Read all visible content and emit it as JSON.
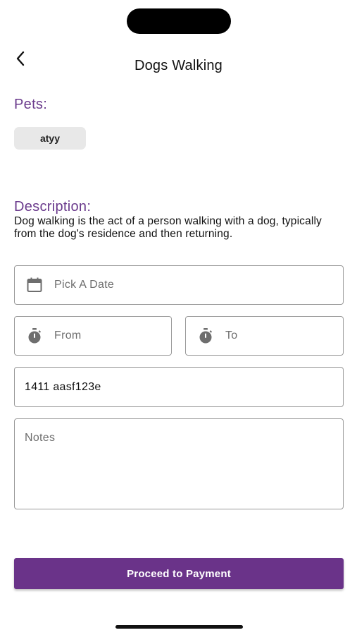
{
  "header": {
    "back_icon": "chevron-left-icon",
    "title": "Dogs Walking"
  },
  "pets": {
    "label": "Pets:",
    "chips": [
      "atyy"
    ]
  },
  "description": {
    "label": "Description:",
    "text": "Dog walking is the act of a person walking with a dog, typically from the dog's residence and then returning."
  },
  "form": {
    "date": {
      "icon": "calendar-icon",
      "placeholder": "Pick A Date"
    },
    "from": {
      "icon": "stopwatch-icon",
      "placeholder": "From"
    },
    "to": {
      "icon": "stopwatch-icon",
      "placeholder": "To"
    },
    "address": {
      "value": "1411 aasf123e"
    },
    "notes": {
      "placeholder": "Notes"
    }
  },
  "actions": {
    "proceed_label": "Proceed to Payment"
  },
  "colors": {
    "accent": "#6a3389",
    "section_label": "#6a3a8c",
    "chip_bg": "#e8e8e8",
    "field_border": "#9a9a9a"
  }
}
